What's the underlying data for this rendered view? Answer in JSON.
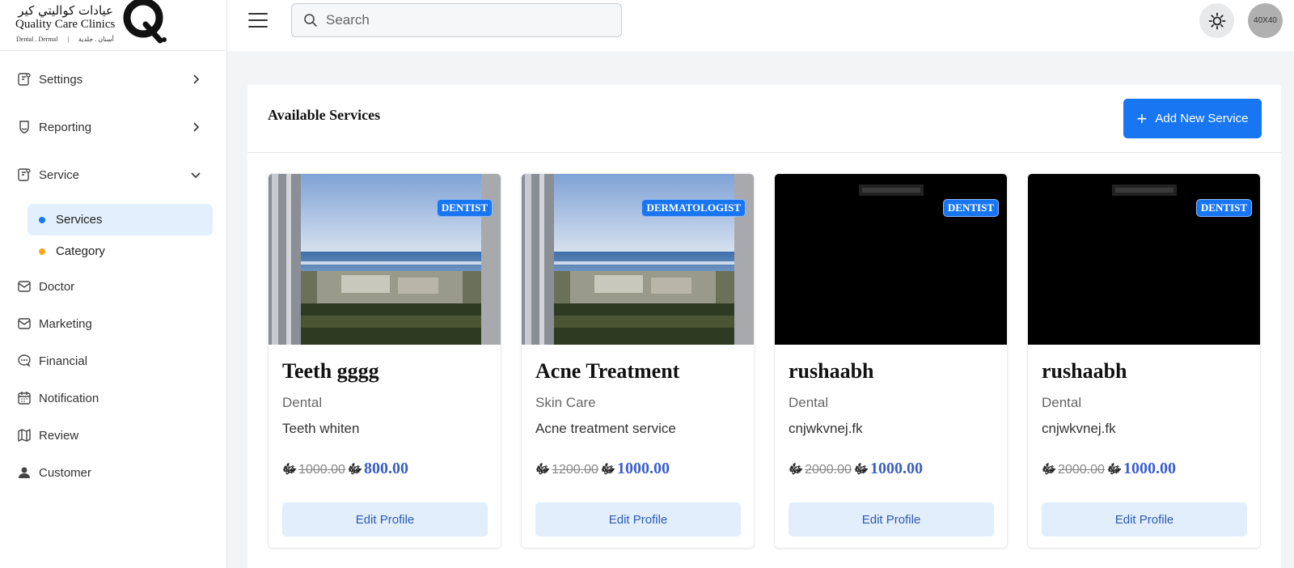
{
  "brand": {
    "arabic_name": "عيادات كواليتي كير",
    "english_name": "Quality Care Clinics",
    "tagline_en": "Dental . Dermal",
    "tagline_ar": "أسنان . جلدية"
  },
  "sidebar": {
    "items": [
      {
        "label": "Settings",
        "icon": "settings-icon",
        "expandable": true,
        "expanded": false
      },
      {
        "label": "Reporting",
        "icon": "reporting-icon",
        "expandable": true,
        "expanded": false
      },
      {
        "label": "Service",
        "icon": "service-icon",
        "expandable": true,
        "expanded": true
      },
      {
        "label": "Doctor",
        "icon": "mail-icon",
        "expandable": false
      },
      {
        "label": "Marketing",
        "icon": "mail-icon",
        "expandable": false
      },
      {
        "label": "Financial",
        "icon": "chat-icon",
        "expandable": false
      },
      {
        "label": "Notification",
        "icon": "calendar-icon",
        "expandable": false
      },
      {
        "label": "Review",
        "icon": "map-icon",
        "expandable": false
      },
      {
        "label": "Customer",
        "icon": "user-icon",
        "expandable": false
      }
    ],
    "service_sub": [
      {
        "label": "Services",
        "active": true,
        "dot_color": "#1976f2"
      },
      {
        "label": "Category",
        "active": false,
        "dot_color": "#f5a623"
      }
    ]
  },
  "header": {
    "search_placeholder": "Search",
    "avatar_text": "40X40"
  },
  "main": {
    "title": "Available Services",
    "add_button_label": "Add New Service",
    "edit_label": "Edit Profile",
    "currency_symbol": "ﷻ",
    "services": [
      {
        "title": "Teeth gggg",
        "category": "Dental",
        "description": "Teeth whiten",
        "badge": "DENTIST",
        "old_price": "1000.00",
        "new_price": "800.00",
        "image": "beach"
      },
      {
        "title": "Acne Treatment",
        "category": "Skin Care",
        "description": "Acne treatment service",
        "badge": "DERMATOLOGIST",
        "old_price": "1200.00",
        "new_price": "1000.00",
        "image": "beach"
      },
      {
        "title": "rushaabh",
        "category": "Dental",
        "description": "cnjwkvnej.fk",
        "badge": "DENTIST",
        "old_price": "2000.00",
        "new_price": "1000.00",
        "image": "black"
      },
      {
        "title": "rushaabh",
        "category": "Dental",
        "description": "cnjwkvnej.fk",
        "badge": "DENTIST",
        "old_price": "2000.00",
        "new_price": "1000.00",
        "image": "black"
      }
    ]
  },
  "colors": {
    "accent": "#1976f2",
    "price": "#3b5fc7",
    "active_bg": "#e3effc"
  }
}
